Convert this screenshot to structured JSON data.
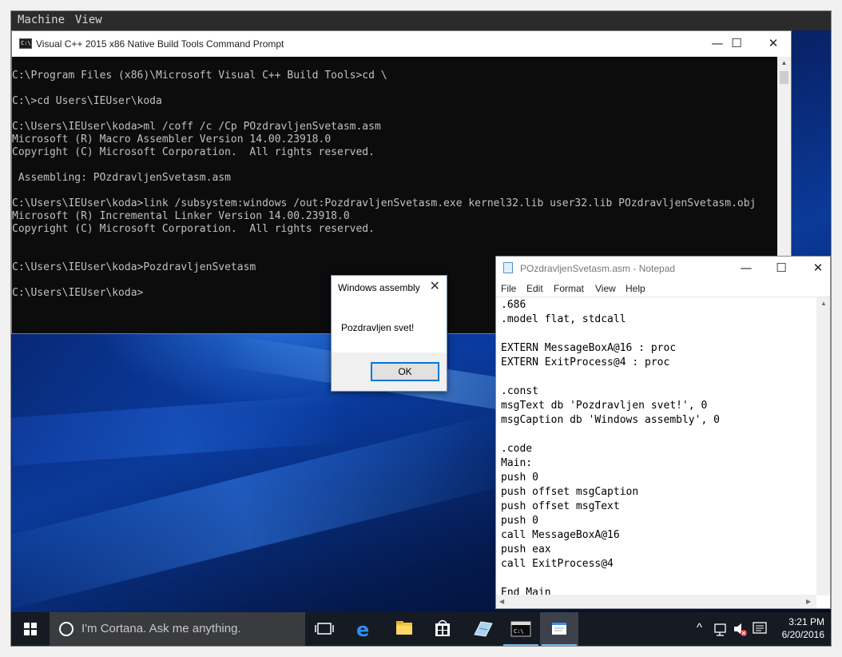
{
  "vm_menu": {
    "machine": "Machine",
    "view": "View"
  },
  "cmd": {
    "title": "Visual C++ 2015 x86 Native Build Tools Command Prompt",
    "icon_text": "C:\\",
    "controls": {
      "minimize": "—",
      "maximize": "☐",
      "close": "✕"
    },
    "lines": [
      "",
      "C:\\Program Files (x86)\\Microsoft Visual C++ Build Tools>cd \\",
      "",
      "C:\\>cd Users\\IEUser\\koda",
      "",
      "C:\\Users\\IEUser\\koda>ml /coff /c /Cp POzdravljenSvetasm.asm",
      "Microsoft (R) Macro Assembler Version 14.00.23918.0",
      "Copyright (C) Microsoft Corporation.  All rights reserved.",
      "",
      " Assembling: POzdravljenSvetasm.asm",
      "",
      "C:\\Users\\IEUser\\koda>link /subsystem:windows /out:PozdravljenSvetasm.exe kernel32.lib user32.lib POzdravljenSvetasm.obj",
      "Microsoft (R) Incremental Linker Version 14.00.23918.0",
      "Copyright (C) Microsoft Corporation.  All rights reserved.",
      "",
      "",
      "C:\\Users\\IEUser\\koda>PozdravljenSvetasm",
      "",
      "C:\\Users\\IEUser\\koda>"
    ]
  },
  "messagebox": {
    "title": "Windows assembly",
    "close": "✕",
    "text": "Pozdravljen svet!",
    "ok_label": "OK"
  },
  "notepad": {
    "title": "POzdravljenSvetasm.asm - Notepad",
    "controls": {
      "minimize": "—",
      "maximize": "☐",
      "close": "✕"
    },
    "menu": [
      "File",
      "Edit",
      "Format",
      "View",
      "Help"
    ],
    "lines": [
      ".686",
      ".model flat, stdcall",
      "",
      "EXTERN MessageBoxA@16 : proc",
      "EXTERN ExitProcess@4 : proc",
      "",
      ".const",
      "msgText db 'Pozdravljen svet!', 0",
      "msgCaption db 'Windows assembly', 0",
      "",
      ".code",
      "Main:",
      "push 0",
      "push offset msgCaption",
      "push offset msgText",
      "push 0",
      "call MessageBoxA@16",
      "push eax",
      "call ExitProcess@4",
      "",
      "End Main"
    ]
  },
  "taskbar": {
    "cortana_placeholder": "I'm Cortana. Ask me anything.",
    "icons": [
      "task-view-icon",
      "edge-icon",
      "file-explorer-icon",
      "store-icon",
      "notepad-pin-icon",
      "cmd-icon",
      "active-app-icon"
    ],
    "tray": {
      "chevron": "^"
    },
    "clock": {
      "time": "3:21 PM",
      "date": "6/20/2016"
    },
    "accent_color": "#76b9ed"
  }
}
